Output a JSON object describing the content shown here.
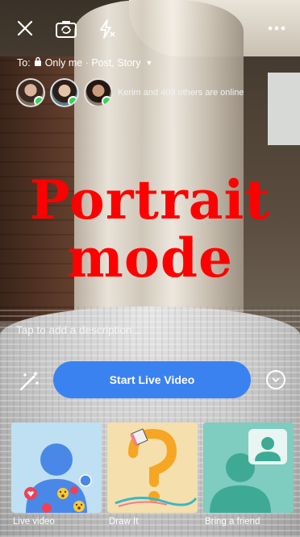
{
  "top_bar": {
    "close_icon": "close-icon",
    "flip_icon": "flip-camera-icon",
    "flash_icon": "flash-off-icon",
    "more_icon": "more-icon"
  },
  "audience": {
    "prefix": "To:",
    "value": "Only me · Post, Story"
  },
  "online": {
    "text": "Kerim and 409 others are online"
  },
  "watermark": {
    "line1": "Portrait",
    "line2": "mode"
  },
  "description_placeholder": "Tap to add a description...",
  "start_button": "Start Live Video",
  "cards": [
    {
      "label": "Live video",
      "icon": "live-video-illustration"
    },
    {
      "label": "Draw It",
      "icon": "draw-it-illustration"
    },
    {
      "label": "Bring a friend",
      "icon": "bring-friend-illustration"
    }
  ],
  "colors": {
    "accent": "#3b82f1",
    "watermark": "#ff0000",
    "online_dot": "#3cd05c"
  }
}
